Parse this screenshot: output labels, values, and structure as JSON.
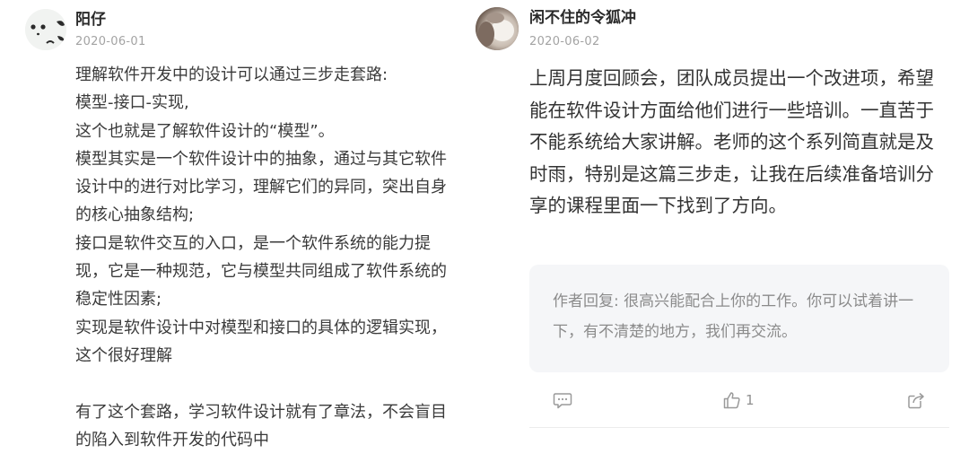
{
  "left": {
    "username": "阳仔",
    "date": "2020-06-01",
    "comment": "理解软件开发中的设计可以通过三步走套路:\n模型-接口-实现,\n这个也就是了解软件设计的“模型”。\n模型其实是一个软件设计中的抽象，通过与其它软件设计中的进行对比学习，理解它们的异同，突出自身的核心抽象结构;\n接口是软件交互的入口，是一个软件系统的能力提现，它是一种规范，它与模型共同组成了软件系统的稳定性因素;\n实现是软件设计中对模型和接口的具体的逻辑实现，这个很好理解\n\n有了这个套路，学习软件设计就有了章法，不会盲目的陷入到软件开发的代码中"
  },
  "right": {
    "username": "闲不住的令狐冲",
    "date": "2020-06-02",
    "comment": "上周月度回顾会，团队成员提出一个改进项，希望能在软件设计方面给他们进行一些培训。一直苦于不能系统给大家讲解。老师的这个系列简直就是及时雨，特别是这篇三步走，让我在后续准备培训分享的课程里面一下找到了方向。",
    "reply": "作者回复: 很高兴能配合上你的工作。你可以试着讲一下，有不清楚的地方，我们再交流。",
    "like_count": "1"
  },
  "icons": {
    "comment": "comment-icon",
    "like": "thumbs-up-icon",
    "share": "share-icon"
  }
}
